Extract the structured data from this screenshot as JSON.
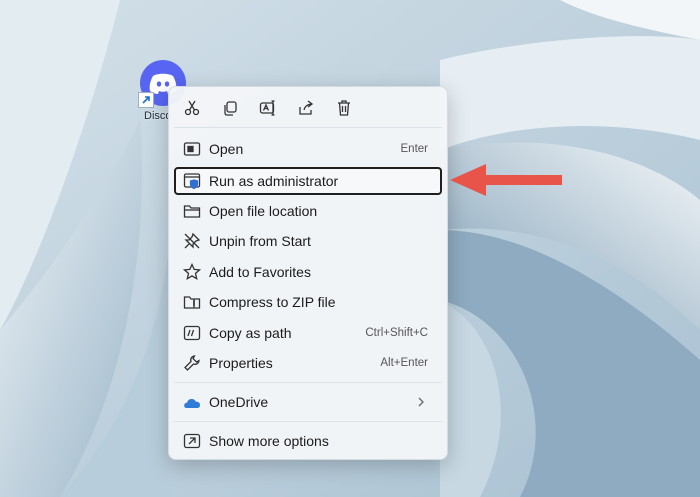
{
  "desktop": {
    "shortcut_label": "Disco"
  },
  "toolbar": {
    "buttons": [
      "cut-icon",
      "copy-icon",
      "rename-icon",
      "share-icon",
      "delete-icon"
    ]
  },
  "menu": {
    "items": [
      {
        "label": "Open",
        "shortcut": "Enter",
        "icon": "open-window-icon"
      },
      {
        "label": "Run as administrator",
        "shortcut": "",
        "icon": "shield-window-icon"
      },
      {
        "label": "Open file location",
        "shortcut": "",
        "icon": "folder-icon"
      },
      {
        "label": "Unpin from Start",
        "shortcut": "",
        "icon": "unpin-icon"
      },
      {
        "label": "Add to Favorites",
        "shortcut": "",
        "icon": "star-icon"
      },
      {
        "label": "Compress to ZIP file",
        "shortcut": "",
        "icon": "zip-folder-icon"
      },
      {
        "label": "Copy as path",
        "shortcut": "Ctrl+Shift+C",
        "icon": "copy-path-icon"
      },
      {
        "label": "Properties",
        "shortcut": "Alt+Enter",
        "icon": "wrench-icon"
      },
      {
        "label": "OneDrive",
        "shortcut": "",
        "icon": "cloud-icon"
      },
      {
        "label": "Show more options",
        "shortcut": "",
        "icon": "more-options-icon"
      }
    ]
  },
  "colors": {
    "discord": "#5865f2",
    "highlight_border": "#1f1f1f",
    "arrow": "#e8534a",
    "onedrive": "#2f7bd8"
  }
}
